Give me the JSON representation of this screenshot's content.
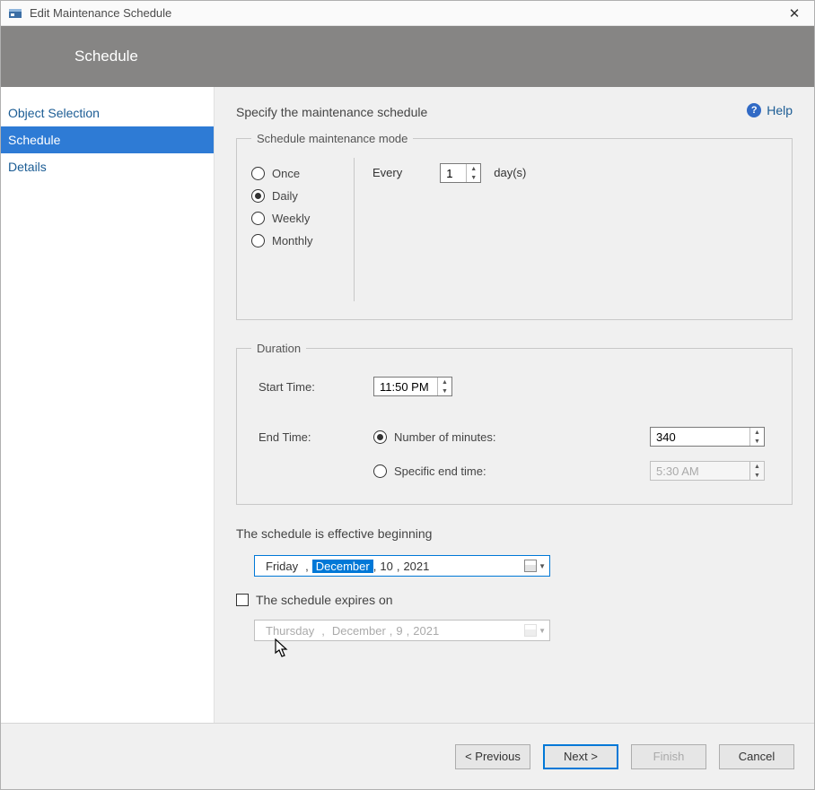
{
  "window": {
    "title": "Edit Maintenance Schedule"
  },
  "banner": {
    "title": "Schedule"
  },
  "sidebar": {
    "items": [
      {
        "label": "Object Selection",
        "active": false
      },
      {
        "label": "Schedule",
        "active": true
      },
      {
        "label": "Details",
        "active": false
      }
    ]
  },
  "help": {
    "label": "Help"
  },
  "content": {
    "instruction": "Specify the maintenance schedule",
    "group_schedule": {
      "legend": "Schedule maintenance mode",
      "options": {
        "once": "Once",
        "daily": "Daily",
        "weekly": "Weekly",
        "monthly": "Monthly"
      },
      "selected": "daily",
      "every_label": "Every",
      "every_value": "1",
      "unit_label": "day(s)"
    },
    "group_duration": {
      "legend": "Duration",
      "start_label": "Start Time:",
      "start_value": "11:50 PM",
      "end_label": "End Time:",
      "minutes_option": "Number of minutes:",
      "minutes_value": "340",
      "specific_option": "Specific end time:",
      "specific_value": "5:30 AM",
      "selected": "minutes"
    },
    "effective": {
      "label": "The schedule is effective beginning",
      "weekday": "Friday",
      "month": "December",
      "day": "10",
      "year": "2021"
    },
    "expires": {
      "checkbox_label": "The schedule expires on",
      "checked": false,
      "weekday": "Thursday",
      "month": "December",
      "day": "9",
      "year": "2021"
    }
  },
  "footer": {
    "previous": "< Previous",
    "next": "Next >",
    "finish": "Finish",
    "cancel": "Cancel"
  }
}
